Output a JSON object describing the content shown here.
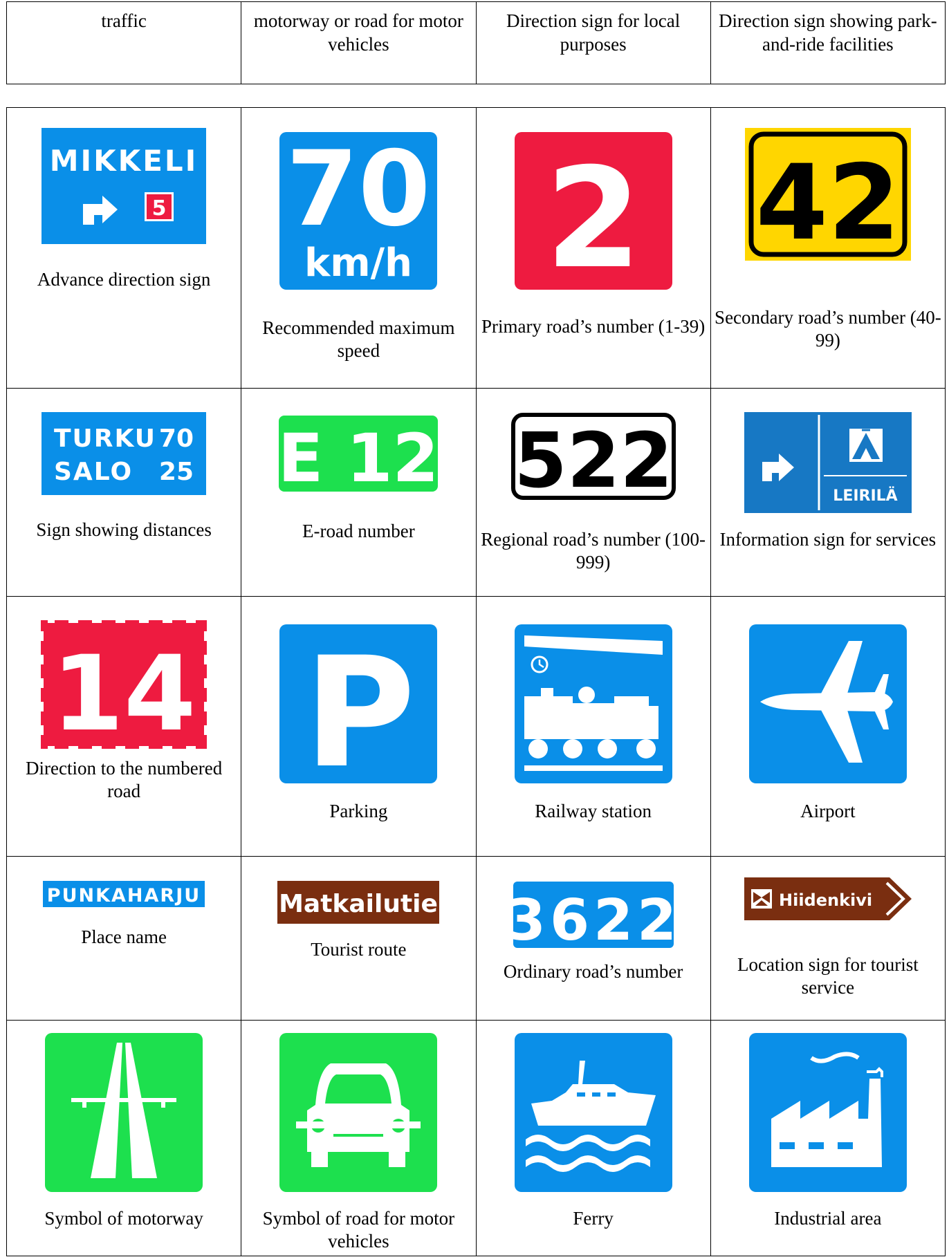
{
  "header": {
    "cells": [
      "traffic",
      "motorway or road for motor vehicles",
      "Direction sign for local purposes",
      "Direction sign showing park-and-ride facilities"
    ]
  },
  "signs": [
    {
      "caption": "Advance direction sign",
      "text": [
        "MIKKELI",
        "5"
      ],
      "icon": "arrow-right-turn-icon",
      "color": "#0a8fe8"
    },
    {
      "caption": "Recommended maximum speed",
      "text": [
        "70",
        "km/h"
      ],
      "color": "#0a8fe8"
    },
    {
      "caption": "Primary road’s number (1-39)",
      "text": [
        "2"
      ],
      "color": "#ee1b40"
    },
    {
      "caption": "Secondary road’s number (40-99)",
      "text": [
        "42"
      ],
      "color": "#ffd600"
    },
    {
      "caption": "Sign showing distances",
      "text": [
        "TURKU",
        "70",
        "SALO",
        "25"
      ],
      "color": "#0a8fe8"
    },
    {
      "caption": "E-road number",
      "text": [
        "E 12"
      ],
      "color": "#1de04e"
    },
    {
      "caption": "Regional road’s number (100-999)",
      "text": [
        "522"
      ],
      "color": "#ffffff"
    },
    {
      "caption": "Information sign for services",
      "text": [
        "LEIRILÄ"
      ],
      "icon": "camping-tent-icon",
      "color": "#1778c4"
    },
    {
      "caption": "Direction to the numbered road",
      "text": [
        "14"
      ],
      "color": "#ee1b40"
    },
    {
      "caption": "Parking",
      "text": [
        "P"
      ],
      "color": "#0a8fe8"
    },
    {
      "caption": "Railway station",
      "icon": "train-icon",
      "color": "#0a8fe8"
    },
    {
      "caption": "Airport",
      "icon": "airplane-icon",
      "color": "#0a8fe8"
    },
    {
      "caption": "Place name",
      "text": [
        "PUNKAHARJU"
      ],
      "color": "#0a8fe8"
    },
    {
      "caption": "Tourist route",
      "text": [
        "Matkailutie"
      ],
      "color": "#7a2e10"
    },
    {
      "caption": "Ordinary road’s number",
      "text": [
        "3622"
      ],
      "color": "#0a8fe8"
    },
    {
      "caption": "Location sign for tourist service",
      "text": [
        "Hiidenkivi"
      ],
      "icon": "butterfly-icon",
      "color": "#7a2e10"
    },
    {
      "caption": "Symbol of motorway",
      "icon": "motorway-icon",
      "color": "#1de04e"
    },
    {
      "caption": "Symbol of road for motor vehicles",
      "icon": "car-icon",
      "color": "#1de04e"
    },
    {
      "caption": "Ferry",
      "icon": "ferry-icon",
      "color": "#0a8fe8"
    },
    {
      "caption": "Industrial area",
      "icon": "factory-icon",
      "color": "#0a8fe8"
    }
  ]
}
